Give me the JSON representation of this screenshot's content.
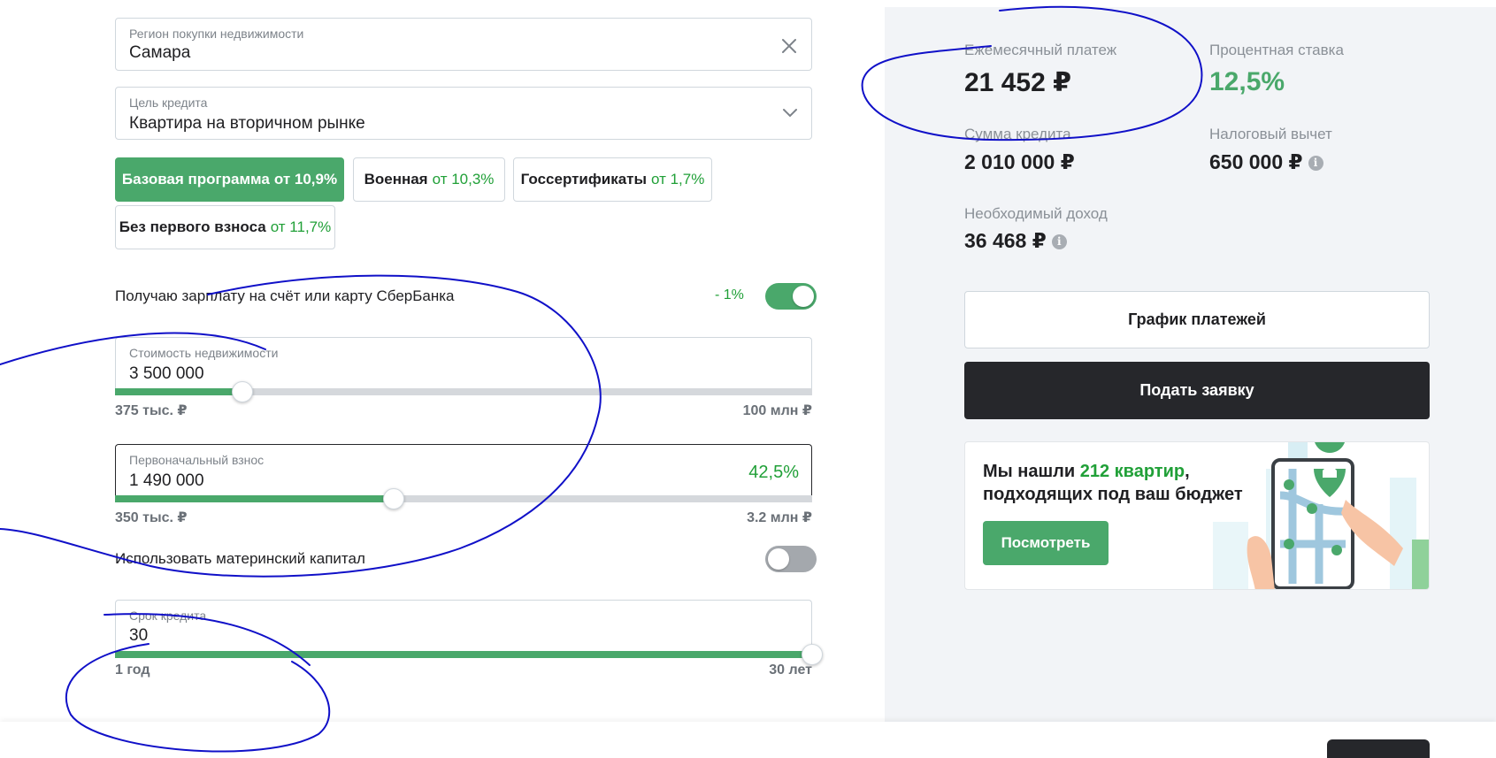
{
  "form": {
    "region": {
      "label": "Регион покупки недвижимости",
      "value": "Самара"
    },
    "purpose": {
      "label": "Цель кредита",
      "value": "Квартира на вторичном рынке"
    },
    "programs": [
      {
        "name": "Базовая программа",
        "rate": "от 10,9%",
        "active": true
      },
      {
        "name": "Военная",
        "rate": "от 10,3%",
        "active": false
      },
      {
        "name": "Госсертификаты",
        "rate": "от 1,7%",
        "active": false
      },
      {
        "name": "Без первого взноса",
        "rate": "от 11,7%",
        "active": false
      }
    ],
    "salary": {
      "label": "Получаю зарплату на счёт или карту СберБанка",
      "discount": "- 1%",
      "enabled": true
    },
    "price": {
      "label": "Стоимость недвижимости",
      "value": "3 500 000",
      "min": "375 тыс. ₽",
      "max": "100 млн ₽",
      "fraction": 0.183
    },
    "down_payment": {
      "label": "Первоначальный взнос",
      "value": "1 490 000",
      "percent": "42,5%",
      "min": "350 тыс. ₽",
      "max": "3.2 млн ₽",
      "fraction": 0.4
    },
    "maternity": {
      "label": "Использовать материнский капитал",
      "enabled": false
    },
    "term": {
      "label": "Срок кредита",
      "value": "30",
      "min": "1 год",
      "max": "30 лет",
      "fraction": 1.0
    }
  },
  "results": {
    "monthly": {
      "label": "Ежемесячный платеж",
      "value": "21 452 ₽"
    },
    "rate": {
      "label": "Процентная ставка",
      "value": "12,5%"
    },
    "loan": {
      "label": "Сумма кредита",
      "value": "2 010 000 ₽"
    },
    "tax": {
      "label": "Налоговый вычет",
      "value": "650 000 ₽"
    },
    "income": {
      "label": "Необходимый доход",
      "value": "36 468 ₽"
    }
  },
  "actions": {
    "schedule": "График платежей",
    "apply": "Подать заявку"
  },
  "promo": {
    "line1_prefix": "Мы нашли",
    "line1_accent": "212 квартир",
    "line1_suffix": ",",
    "line2": "подходящих под ваш бюджет",
    "button": "Посмотреть"
  },
  "icons": {
    "clear": "close-icon",
    "dropdown": "chevron-down-icon",
    "info": "info-icon"
  },
  "colors": {
    "accent": "#4aa86b",
    "accent_text": "#21a038",
    "dark_button": "#26272b",
    "annotation": "#1010c8"
  }
}
